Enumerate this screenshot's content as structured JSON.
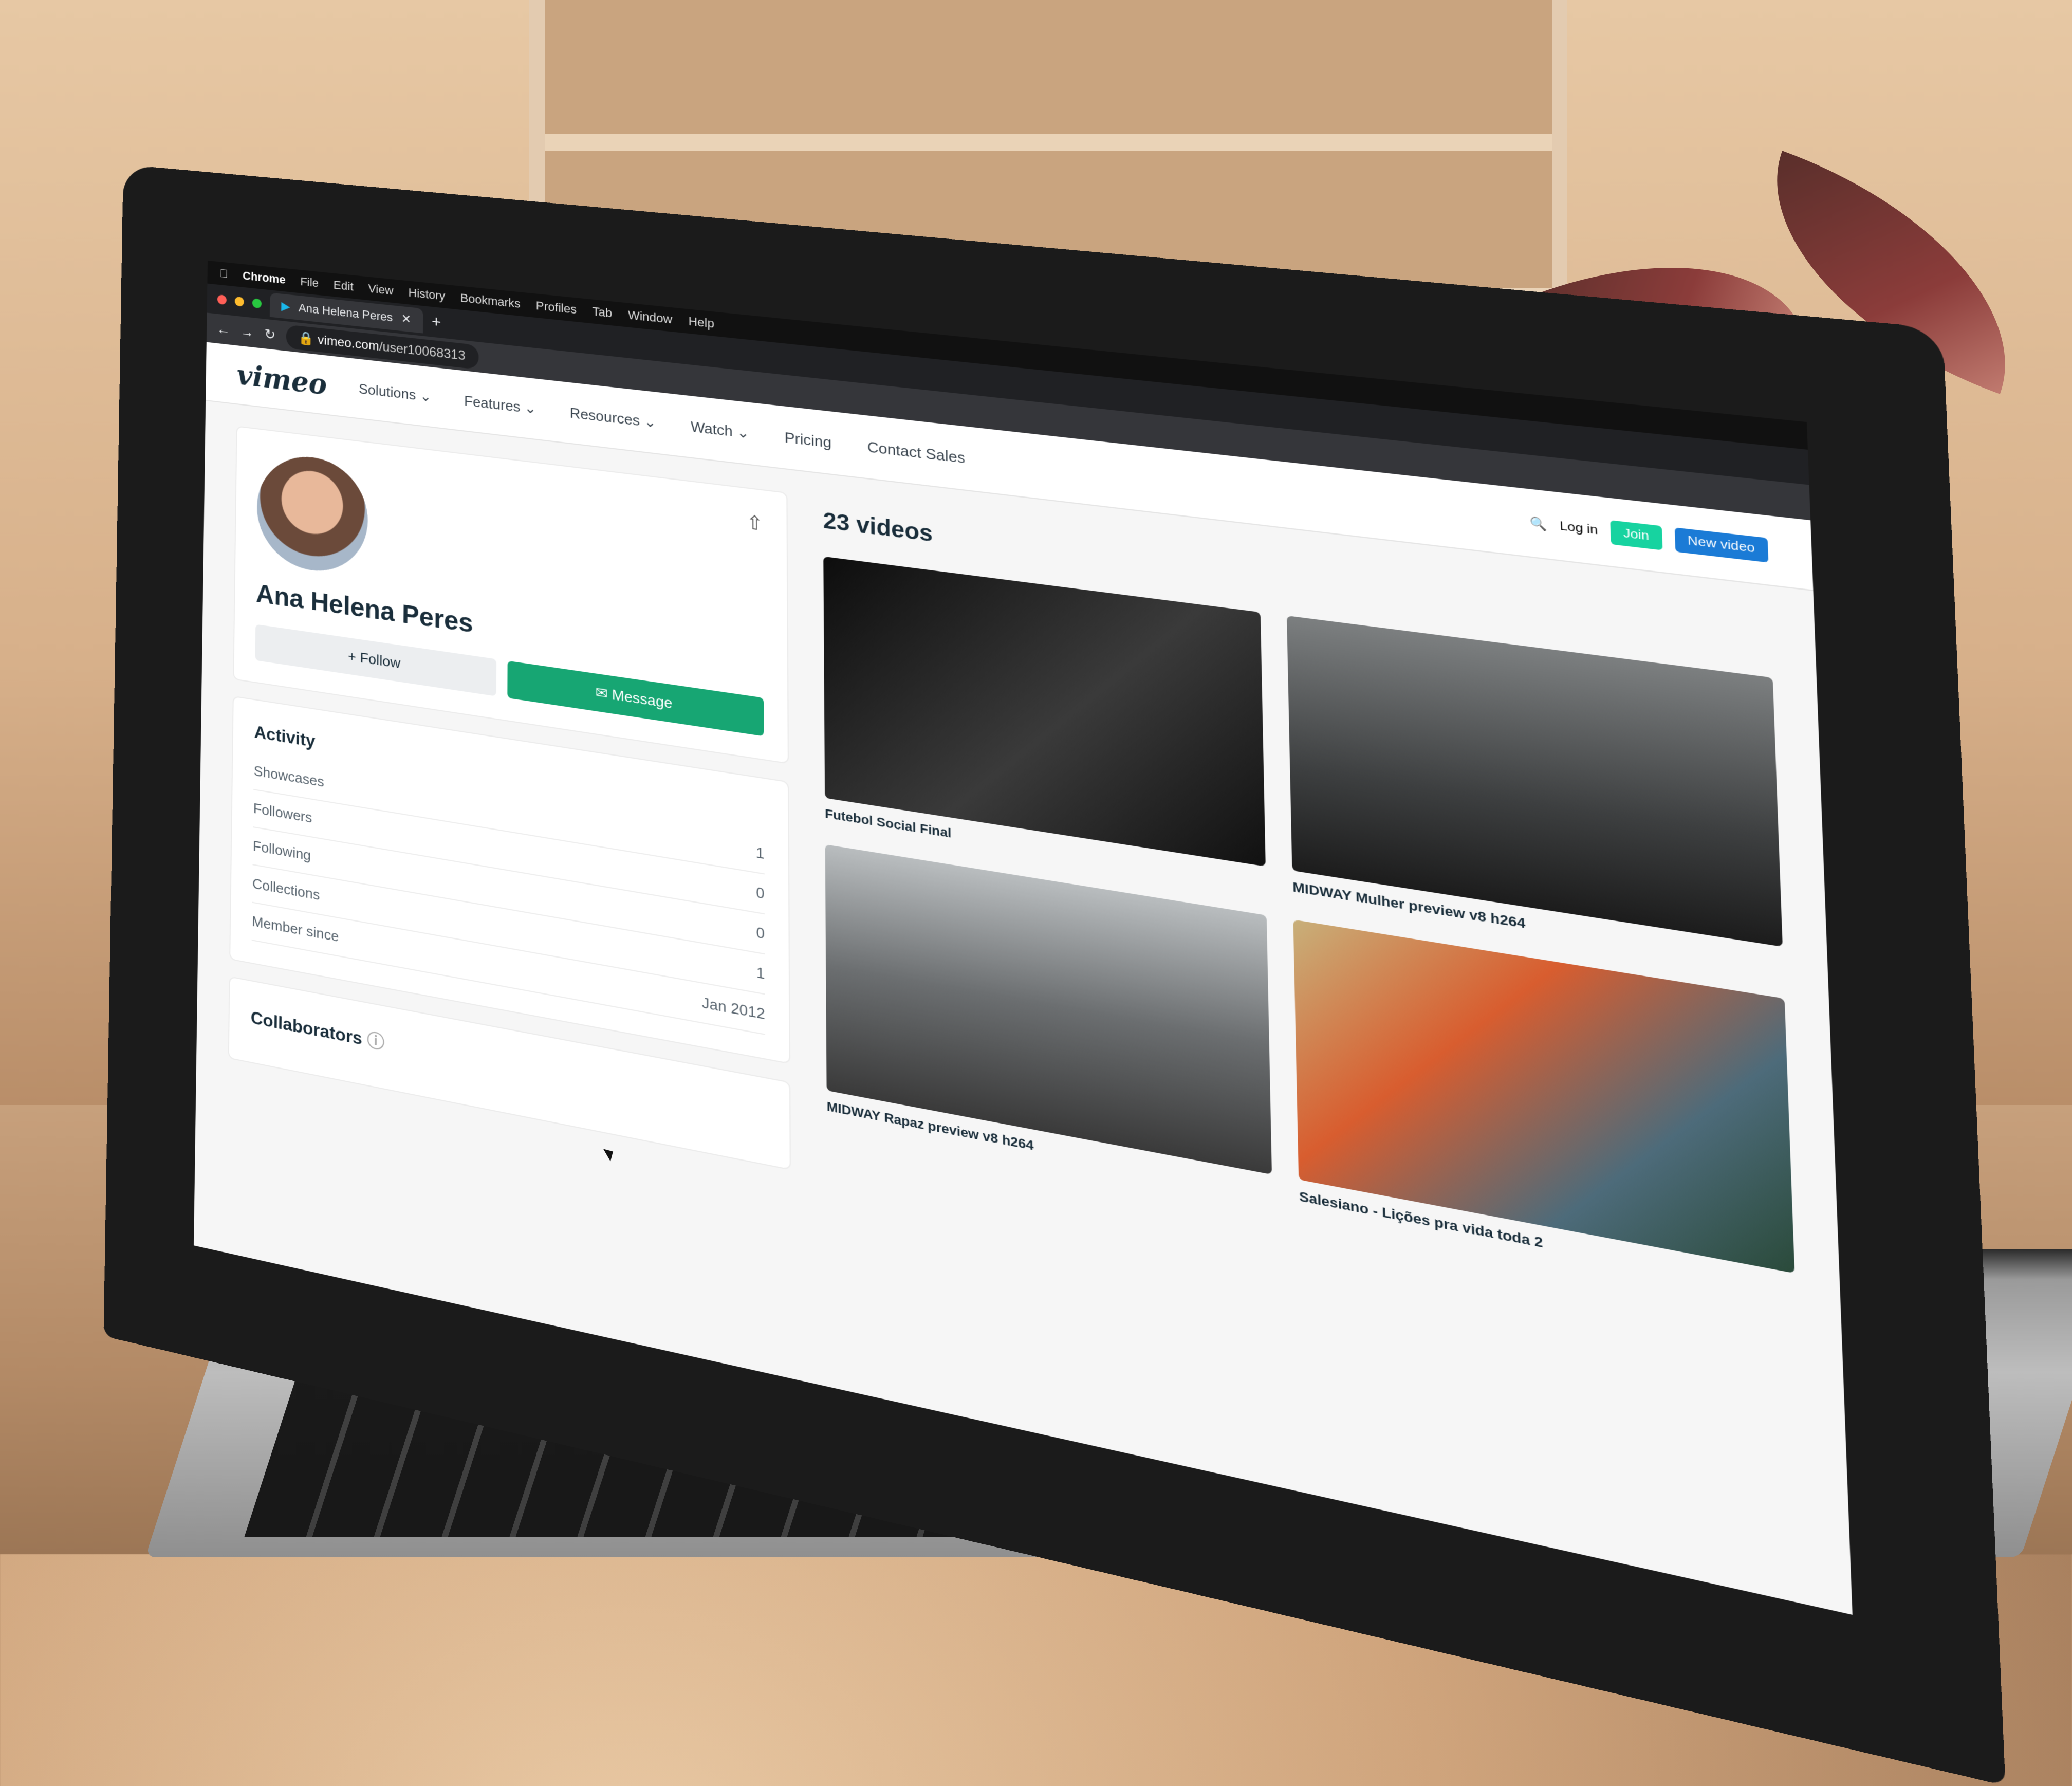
{
  "mac_menu": [
    "Chrome",
    "File",
    "Edit",
    "View",
    "History",
    "Bookmarks",
    "Profiles",
    "Tab",
    "Window",
    "Help"
  ],
  "browser": {
    "tab_title": "Ana Helena Peres",
    "url_host": "vimeo.com",
    "url_path": "/user10068313"
  },
  "vimeo": {
    "logo": "vimeo",
    "nav": [
      "Solutions",
      "Features",
      "Resources",
      "Watch",
      "Pricing",
      "Contact Sales"
    ],
    "login": "Log in",
    "join": "Join",
    "new_video": "New video"
  },
  "profile": {
    "name": "Ana Helena Peres",
    "follow_label": "+ Follow",
    "message_label": "Message"
  },
  "activity": {
    "title": "Activity",
    "rows": [
      {
        "label": "Showcases",
        "value": "1"
      },
      {
        "label": "Followers",
        "value": "0"
      },
      {
        "label": "Following",
        "value": "0"
      },
      {
        "label": "Collections",
        "value": "1"
      },
      {
        "label": "Member since",
        "value": "Jan 2012"
      }
    ]
  },
  "collaborators": {
    "title": "Collaborators"
  },
  "videos": {
    "count_label": "23 videos",
    "items": [
      {
        "title": "Futebol Social Final"
      },
      {
        "title": "MIDWAY Mulher preview v8 h264"
      },
      {
        "title": "MIDWAY Rapaz preview v8 h264"
      },
      {
        "title": "Salesiano - Lições pra vida toda 2"
      }
    ]
  },
  "colors": {
    "accent_green": "#17a673",
    "join_green": "#17d3a0",
    "blue": "#1b7bd6"
  }
}
